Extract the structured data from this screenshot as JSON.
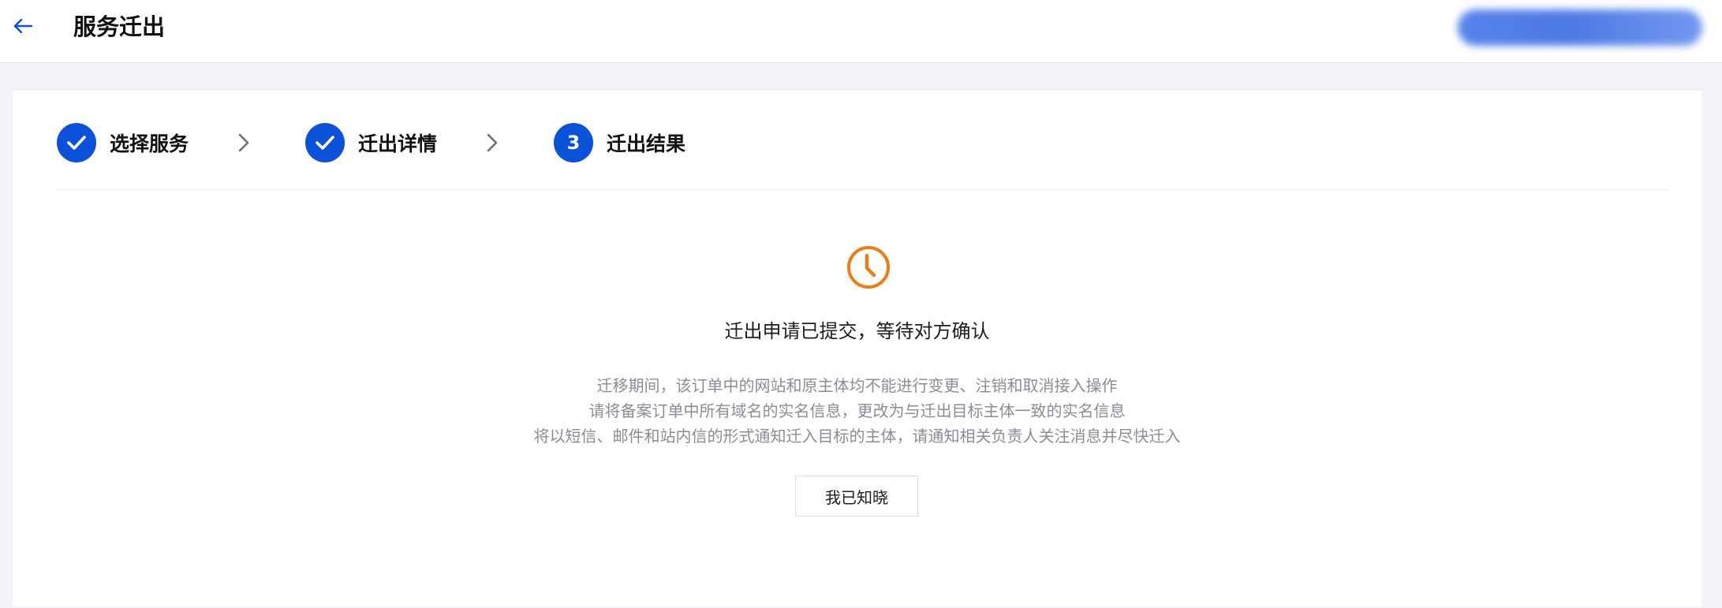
{
  "header": {
    "title": "服务迁出",
    "back_icon": "arrow-left-icon",
    "accent_color": "#0a52d9"
  },
  "steps": [
    {
      "label": "选择服务",
      "state": "done",
      "icon": "check-icon"
    },
    {
      "label": "迁出详情",
      "state": "done",
      "icon": "check-icon"
    },
    {
      "label": "迁出结果",
      "state": "current",
      "number": "3"
    }
  ],
  "result": {
    "icon": "clock-icon",
    "icon_color": "#f07c0f",
    "title": "迁出申请已提交，等待对方确认",
    "lines": [
      "迁移期间，该订单中的网站和原主体均不能进行变更、注销和取消接入操作",
      "请将备案订单中所有域名的实名信息，更改为与迁出目标主体一致的实名信息",
      "将以短信、邮件和站内信的形式通知迁入目标的主体，请通知相关负责人关注消息并尽快迁入"
    ],
    "button_label": "我已知晓"
  }
}
